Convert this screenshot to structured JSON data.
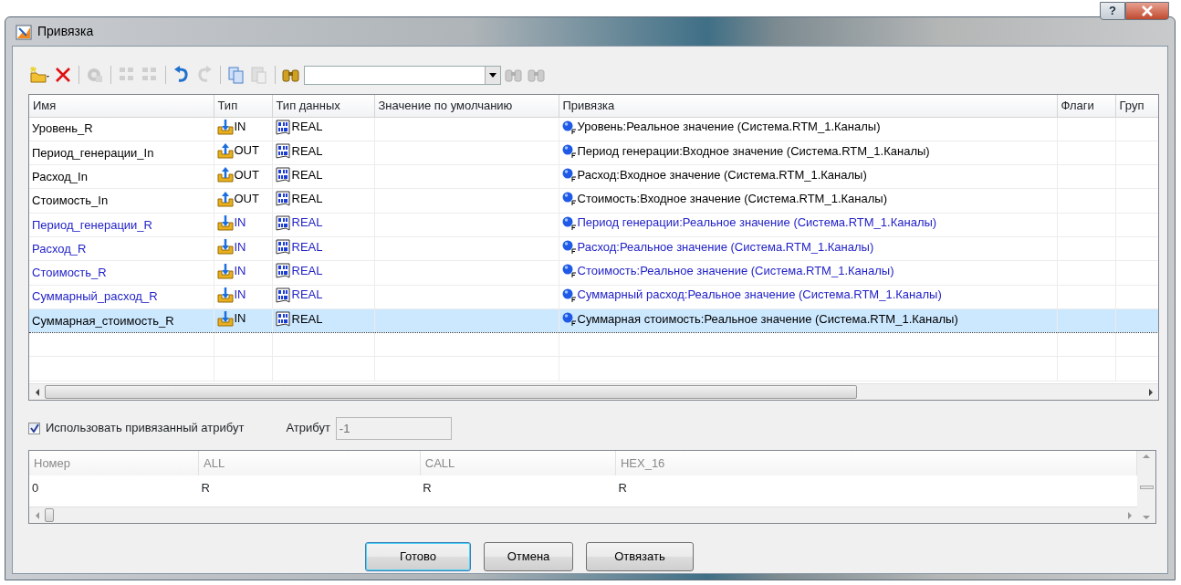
{
  "window": {
    "title": "Привязка",
    "help_button": "?"
  },
  "toolbar": [
    {
      "kind": "new",
      "disabled": false
    },
    {
      "kind": "delete",
      "disabled": false
    },
    {
      "kind": "sep"
    },
    {
      "kind": "link",
      "disabled": true
    },
    {
      "kind": "sep"
    },
    {
      "kind": "grid",
      "disabled": true
    },
    {
      "kind": "grid",
      "disabled": true
    },
    {
      "kind": "sep"
    },
    {
      "kind": "undo",
      "disabled": false
    },
    {
      "kind": "redo",
      "disabled": true
    },
    {
      "kind": "sep"
    },
    {
      "kind": "copy",
      "disabled": false
    },
    {
      "kind": "paste",
      "disabled": true
    },
    {
      "kind": "sep"
    },
    {
      "kind": "find",
      "disabled": false
    },
    {
      "kind": "combo"
    },
    {
      "kind": "find",
      "disabled": true
    },
    {
      "kind": "find",
      "disabled": true
    }
  ],
  "table": {
    "columns": [
      "Имя",
      "Тип",
      "Тип данных",
      "Значение по умолчанию",
      "Привязка",
      "Флаги",
      "Груп"
    ],
    "rows": [
      {
        "name": "Уровень_R",
        "type": "IN",
        "kind": "in",
        "data_type": "REAL",
        "binding": "Уровень:Реальное значение (Система.RTM_1.Каналы)",
        "color": "#000000",
        "selected": false
      },
      {
        "name": "Период_генерации_In",
        "type": "OUT",
        "kind": "out",
        "data_type": "REAL",
        "binding": "Период генерации:Входное значение (Система.RTM_1.Каналы)",
        "color": "#000000",
        "selected": false
      },
      {
        "name": "Расход_In",
        "type": "OUT",
        "kind": "out",
        "data_type": "REAL",
        "binding": "Расход:Входное значение (Система.RTM_1.Каналы)",
        "color": "#000000",
        "selected": false
      },
      {
        "name": "Стоимость_In",
        "type": "OUT",
        "kind": "out",
        "data_type": "REAL",
        "binding": "Стоимость:Входное значение (Система.RTM_1.Каналы)",
        "color": "#000000",
        "selected": false
      },
      {
        "name": "Период_генерации_R",
        "type": "IN",
        "kind": "in",
        "data_type": "REAL",
        "binding": "Период генерации:Реальное значение (Система.RTM_1.Каналы)",
        "color": "#2323c8",
        "selected": false
      },
      {
        "name": "Расход_R",
        "type": "IN",
        "kind": "in",
        "data_type": "REAL",
        "binding": "Расход:Реальное значение (Система.RTM_1.Каналы)",
        "color": "#2323c8",
        "selected": false
      },
      {
        "name": "Стоимость_R",
        "type": "IN",
        "kind": "in",
        "data_type": "REAL",
        "binding": "Стоимость:Реальное значение (Система.RTM_1.Каналы)",
        "color": "#2323c8",
        "selected": false
      },
      {
        "name": "Суммарный_расход_R",
        "type": "IN",
        "kind": "in",
        "data_type": "REAL",
        "binding": "Суммарный расход:Реальное значение (Система.RTM_1.Каналы)",
        "color": "#2323c8",
        "selected": false
      },
      {
        "name": "Суммарная_стоимость_R",
        "type": "IN",
        "kind": "in",
        "data_type": "REAL",
        "binding": "Суммарная стоимость:Реальное значение (Система.RTM_1.Каналы)",
        "color": "#000000",
        "selected": true
      }
    ]
  },
  "use_attribute": {
    "label": "Использовать привязанный атрибут",
    "checked": true
  },
  "attribute": {
    "label": "Атрибут",
    "value": "-1",
    "disabled": true
  },
  "bits_table": {
    "columns": [
      "Номер",
      "ALL",
      "CALL",
      "HEX_16"
    ],
    "rows": [
      [
        "0",
        "R",
        "R",
        "R"
      ]
    ]
  },
  "buttons": [
    {
      "label": "Готово",
      "default": true
    },
    {
      "label": "Отмена",
      "default": false
    },
    {
      "label": "Отвязать",
      "default": false
    }
  ]
}
